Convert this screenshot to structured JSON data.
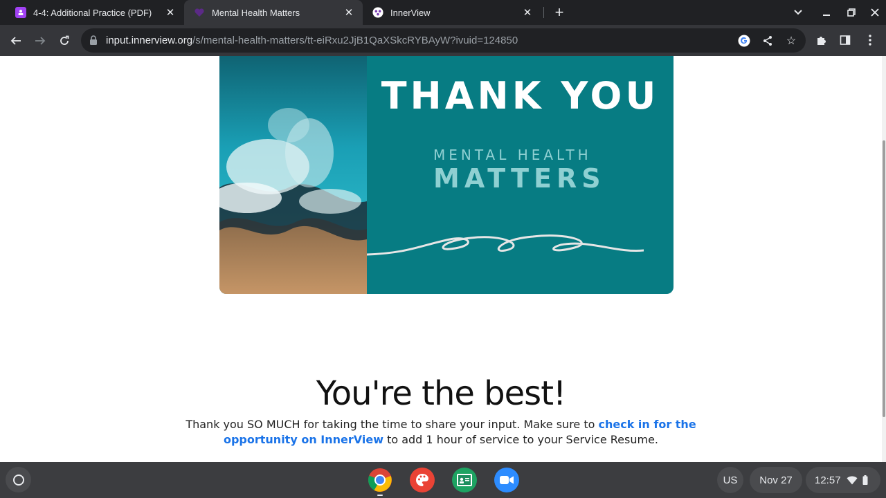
{
  "tabs": [
    {
      "title": "4-4: Additional Practice (PDF)",
      "active": false
    },
    {
      "title": "Mental Health Matters",
      "active": true
    },
    {
      "title": "InnerView",
      "active": false
    }
  ],
  "address_bar": {
    "host": "input.innerview.org",
    "path": "/s/mental-health-matters/tt-eiRxu2JjB1QaXSkcRYBAyW?ivuid=124850"
  },
  "banner": {
    "title": "THANK YOU",
    "subtitle_line1": "MENTAL  HEALTH",
    "subtitle_line2": "MATTERS"
  },
  "content": {
    "heading": "You're the best!",
    "text_before_link": "Thank you SO MUCH for taking the time to share your input. Make sure to ",
    "link_text": "check in for the opportunity on InnerView",
    "text_after_link": " to add 1 hour of service to your Service Resume."
  },
  "shelf": {
    "ime": "US",
    "date": "Nov 27",
    "time": "12:57"
  },
  "colors": {
    "banner_teal": "#077c83",
    "link_blue": "#1a73e8",
    "tab_active": "#35363a",
    "frame": "#202124"
  }
}
